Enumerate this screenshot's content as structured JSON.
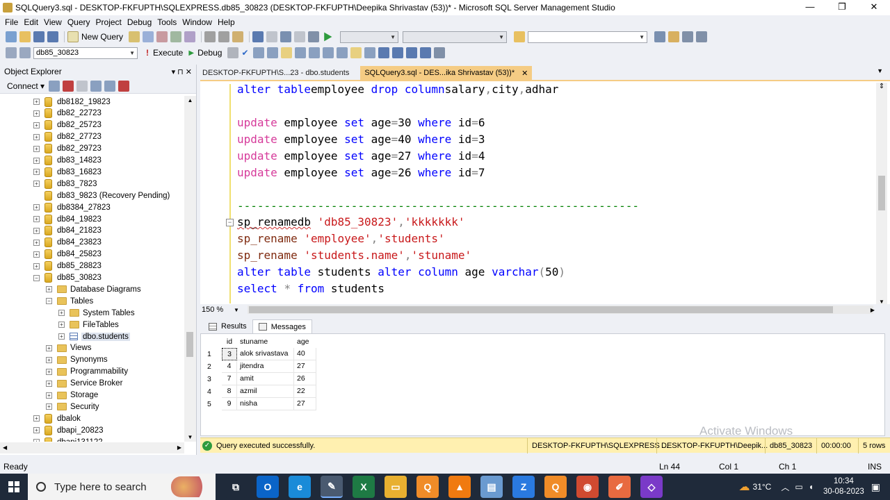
{
  "window": {
    "title": "SQLQuery3.sql - DESKTOP-FKFUPTH\\SQLEXPRESS.db85_30823 (DESKTOP-FKFUPTH\\Deepika Shrivastav (53))* - Microsoft SQL Server Management Studio",
    "minimize": "—",
    "restore": "❐",
    "close": "✕"
  },
  "menu": [
    "File",
    "Edit",
    "View",
    "Query",
    "Project",
    "Debug",
    "Tools",
    "Window",
    "Help"
  ],
  "toolbar": {
    "new_query": "New Query",
    "database": "db85_30823",
    "execute": "Execute",
    "debug": "Debug"
  },
  "object_explorer": {
    "title": "Object Explorer",
    "pin": "▾ ⊓ ✕",
    "connect": "Connect ▾",
    "items": [
      {
        "label": "db8182_19823",
        "type": "db",
        "level": 0,
        "exp": "+"
      },
      {
        "label": "db82_22723",
        "type": "db",
        "level": 0,
        "exp": "+"
      },
      {
        "label": "db82_25723",
        "type": "db",
        "level": 0,
        "exp": "+"
      },
      {
        "label": "db82_27723",
        "type": "db",
        "level": 0,
        "exp": "+"
      },
      {
        "label": "db82_29723",
        "type": "db",
        "level": 0,
        "exp": "+"
      },
      {
        "label": "db83_14823",
        "type": "db",
        "level": 0,
        "exp": "+"
      },
      {
        "label": "db83_16823",
        "type": "db",
        "level": 0,
        "exp": "+"
      },
      {
        "label": "db83_7823",
        "type": "db",
        "level": 0,
        "exp": "+"
      },
      {
        "label": "db83_9823 (Recovery Pending)",
        "type": "db",
        "level": 0,
        "exp": ""
      },
      {
        "label": "db8384_27823",
        "type": "db",
        "level": 0,
        "exp": "+"
      },
      {
        "label": "db84_19823",
        "type": "db",
        "level": 0,
        "exp": "+"
      },
      {
        "label": "db84_21823",
        "type": "db",
        "level": 0,
        "exp": "+"
      },
      {
        "label": "db84_23823",
        "type": "db",
        "level": 0,
        "exp": "+"
      },
      {
        "label": "db84_25823",
        "type": "db",
        "level": 0,
        "exp": "+"
      },
      {
        "label": "db85_28823",
        "type": "db",
        "level": 0,
        "exp": "+"
      },
      {
        "label": "db85_30823",
        "type": "db",
        "level": 0,
        "exp": "−"
      },
      {
        "label": "Database Diagrams",
        "type": "folder",
        "level": 1,
        "exp": "+"
      },
      {
        "label": "Tables",
        "type": "folder",
        "level": 1,
        "exp": "−"
      },
      {
        "label": "System Tables",
        "type": "folder",
        "level": 2,
        "exp": "+"
      },
      {
        "label": "FileTables",
        "type": "folder",
        "level": 2,
        "exp": "+"
      },
      {
        "label": "dbo.students",
        "type": "table",
        "level": 2,
        "exp": "+"
      },
      {
        "label": "Views",
        "type": "folder",
        "level": 1,
        "exp": "+"
      },
      {
        "label": "Synonyms",
        "type": "folder",
        "level": 1,
        "exp": "+"
      },
      {
        "label": "Programmability",
        "type": "folder",
        "level": 1,
        "exp": "+"
      },
      {
        "label": "Service Broker",
        "type": "folder",
        "level": 1,
        "exp": "+"
      },
      {
        "label": "Storage",
        "type": "folder",
        "level": 1,
        "exp": "+"
      },
      {
        "label": "Security",
        "type": "folder",
        "level": 1,
        "exp": "+"
      },
      {
        "label": "dbalok",
        "type": "db",
        "level": 0,
        "exp": "+"
      },
      {
        "label": "dbapi_20823",
        "type": "db",
        "level": 0,
        "exp": "+"
      },
      {
        "label": "dbapi131122",
        "type": "db",
        "level": 0,
        "exp": "+"
      }
    ]
  },
  "tabs": [
    {
      "label": "DESKTOP-FKFUPTH\\S...23 - dbo.students",
      "active": false
    },
    {
      "label": "SQLQuery3.sql - DES...ika Shrivastav (53))*",
      "active": true,
      "close": "✕"
    }
  ],
  "editor": {
    "zoom": "150 %",
    "lines": [
      [
        [
          "kw",
          "alter table"
        ],
        [
          "",
          "employee "
        ],
        [
          "kw",
          "drop column"
        ],
        [
          "",
          "salary"
        ],
        [
          "gray",
          ","
        ],
        [
          "",
          "city"
        ],
        [
          "gray",
          ","
        ],
        [
          "",
          "adhar"
        ]
      ],
      [],
      [
        [
          "kw2",
          "update"
        ],
        [
          "",
          " employee "
        ],
        [
          "kw",
          "set"
        ],
        [
          "",
          " age"
        ],
        [
          "gray",
          "="
        ],
        [
          "",
          "30 "
        ],
        [
          "kw",
          "where"
        ],
        [
          "",
          " id"
        ],
        [
          "gray",
          "="
        ],
        [
          "",
          "6"
        ]
      ],
      [
        [
          "kw2",
          "update"
        ],
        [
          "",
          " employee "
        ],
        [
          "kw",
          "set"
        ],
        [
          "",
          " age"
        ],
        [
          "gray",
          "="
        ],
        [
          "",
          "40 "
        ],
        [
          "kw",
          "where"
        ],
        [
          "",
          " id"
        ],
        [
          "gray",
          "="
        ],
        [
          "",
          "3"
        ]
      ],
      [
        [
          "kw2",
          "update"
        ],
        [
          "",
          " employee "
        ],
        [
          "kw",
          "set"
        ],
        [
          "",
          " age"
        ],
        [
          "gray",
          "="
        ],
        [
          "",
          "27 "
        ],
        [
          "kw",
          "where"
        ],
        [
          "",
          " id"
        ],
        [
          "gray",
          "="
        ],
        [
          "",
          "4"
        ]
      ],
      [
        [
          "kw2",
          "update"
        ],
        [
          "",
          " employee "
        ],
        [
          "kw",
          "set"
        ],
        [
          "",
          " age"
        ],
        [
          "gray",
          "="
        ],
        [
          "",
          "26 "
        ],
        [
          "kw",
          "where"
        ],
        [
          "",
          " id"
        ],
        [
          "gray",
          "="
        ],
        [
          "",
          "7"
        ]
      ],
      [],
      [
        [
          "dash",
          "------------------------------------------------------------"
        ]
      ],
      [
        [
          "squig",
          "sp_renamedb"
        ],
        [
          "",
          " "
        ],
        [
          "str",
          "'db85_30823'"
        ],
        [
          "gray",
          ","
        ],
        [
          "str",
          "'kkkkkkk'"
        ]
      ],
      [
        [
          "fn",
          "sp_rename"
        ],
        [
          "",
          " "
        ],
        [
          "str",
          "'employee'"
        ],
        [
          "gray",
          ","
        ],
        [
          "str",
          "'students'"
        ]
      ],
      [
        [
          "fn",
          "sp_rename"
        ],
        [
          "",
          " "
        ],
        [
          "str",
          "'students.name'"
        ],
        [
          "gray",
          ","
        ],
        [
          "str",
          "'stuname'"
        ]
      ],
      [
        [
          "kw",
          "alter table"
        ],
        [
          "",
          " students "
        ],
        [
          "kw",
          "alter column"
        ],
        [
          "",
          " age "
        ],
        [
          "kw",
          "varchar"
        ],
        [
          "gray",
          "("
        ],
        [
          "",
          "50"
        ],
        [
          "gray",
          ")"
        ]
      ],
      [
        [
          "kw",
          "select"
        ],
        [
          "",
          " "
        ],
        [
          "gray",
          "*"
        ],
        [
          "",
          " "
        ],
        [
          "kw",
          "from"
        ],
        [
          "",
          " students"
        ]
      ]
    ]
  },
  "results": {
    "tab_results": "Results",
    "tab_messages": "Messages",
    "columns": [
      "id",
      "stuname",
      "age"
    ],
    "rows": [
      [
        "1",
        "3",
        "alok srivastava",
        "40"
      ],
      [
        "2",
        "4",
        "jitendra",
        "27"
      ],
      [
        "3",
        "7",
        "amit",
        "26"
      ],
      [
        "4",
        "8",
        "azmil",
        "22"
      ],
      [
        "5",
        "9",
        "nisha",
        "27"
      ]
    ],
    "watermark": "Activate Windows"
  },
  "query_status": {
    "message": "Query executed successfully.",
    "server": "DESKTOP-FKFUPTH\\SQLEXPRESS ...",
    "user": "DESKTOP-FKFUPTH\\Deepik...",
    "database": "db85_30823",
    "elapsed": "00:00:00",
    "rows": "5 rows"
  },
  "status_bar": {
    "ready": "Ready",
    "ln": "Ln 44",
    "col": "Col 1",
    "ch": "Ch 1",
    "ins": "INS"
  },
  "taskbar": {
    "search_placeholder": "Type here to search",
    "temperature": "31°C",
    "time": "10:34",
    "date": "30-08-2023",
    "apps": [
      {
        "name": "task-view",
        "glyph": "⧉",
        "color": "#1f2a3a"
      },
      {
        "name": "outlook",
        "glyph": "O",
        "color": "#0a64c8"
      },
      {
        "name": "edge",
        "glyph": "e",
        "color": "#1a8bd8"
      },
      {
        "name": "ssms",
        "glyph": "✎",
        "color": "#4a5a70"
      },
      {
        "name": "excel",
        "glyph": "X",
        "color": "#1e7a44"
      },
      {
        "name": "file-explorer",
        "glyph": "▭",
        "color": "#e8b030"
      },
      {
        "name": "app-q1",
        "glyph": "Q",
        "color": "#f08c28"
      },
      {
        "name": "vlc",
        "glyph": "▲",
        "color": "#f07a10"
      },
      {
        "name": "notepad",
        "glyph": "▤",
        "color": "#6a9ad0"
      },
      {
        "name": "app-z",
        "glyph": "Z",
        "color": "#2a7ae0"
      },
      {
        "name": "app-q2",
        "glyph": "Q",
        "color": "#f08c28"
      },
      {
        "name": "chrome",
        "glyph": "◉",
        "color": "#d04a30"
      },
      {
        "name": "app-pen",
        "glyph": "✐",
        "color": "#e86a40"
      },
      {
        "name": "visual-studio",
        "glyph": "◇",
        "color": "#7a3ac8"
      }
    ]
  }
}
